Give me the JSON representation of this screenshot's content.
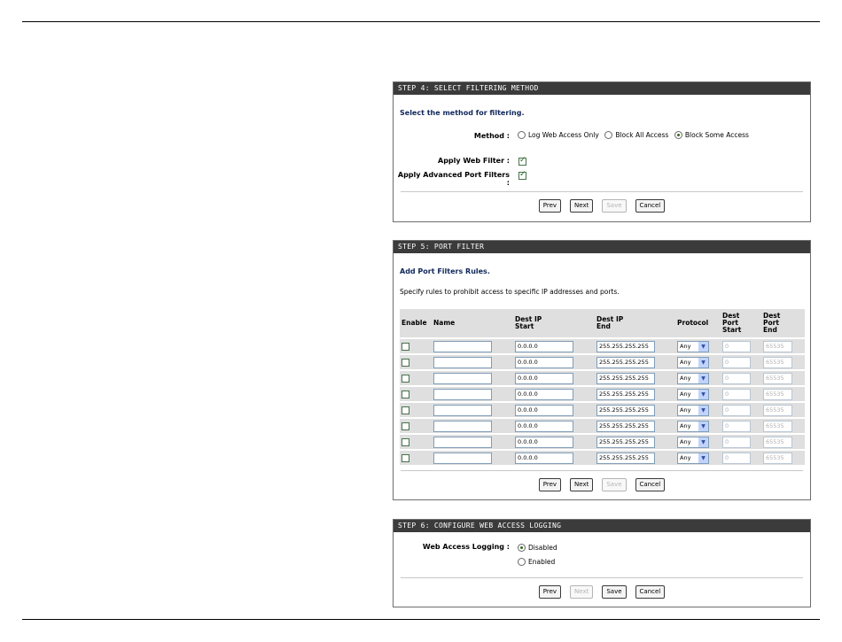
{
  "step4": {
    "header": "STEP 4: SELECT FILTERING METHOD",
    "subheading": "Select the method for filtering.",
    "method_label": "Method :",
    "method_options": [
      "Log Web Access Only",
      "Block All Access",
      "Block Some Access"
    ],
    "method_selected": 2,
    "apply_web_filter_label": "Apply Web Filter :",
    "apply_web_filter_checked": true,
    "apply_port_filters_label": "Apply Advanced Port Filters :",
    "apply_port_filters_checked": true,
    "buttons": {
      "prev": "Prev",
      "next": "Next",
      "save": "Save",
      "cancel": "Cancel"
    }
  },
  "step5": {
    "header": "STEP 5: PORT FILTER",
    "subheading": "Add Port Filters Rules.",
    "description": "Specify rules to prohibit access to specific IP addresses and ports.",
    "columns": {
      "enable": "Enable",
      "name": "Name",
      "dest_ip_start": [
        "Dest IP",
        "Start"
      ],
      "dest_ip_end": [
        "Dest IP",
        "End"
      ],
      "protocol": "Protocol",
      "dest_port_start": [
        "Dest",
        "Port",
        "Start"
      ],
      "dest_port_end": [
        "Dest",
        "Port",
        "End"
      ]
    },
    "rows": [
      {
        "enabled": false,
        "name": "",
        "ip_start": "0.0.0.0",
        "ip_end": "255.255.255.255",
        "protocol": "Any",
        "port_start": "0",
        "port_end": "65535"
      },
      {
        "enabled": false,
        "name": "",
        "ip_start": "0.0.0.0",
        "ip_end": "255.255.255.255",
        "protocol": "Any",
        "port_start": "0",
        "port_end": "65535"
      },
      {
        "enabled": false,
        "name": "",
        "ip_start": "0.0.0.0",
        "ip_end": "255.255.255.255",
        "protocol": "Any",
        "port_start": "0",
        "port_end": "65535"
      },
      {
        "enabled": false,
        "name": "",
        "ip_start": "0.0.0.0",
        "ip_end": "255.255.255.255",
        "protocol": "Any",
        "port_start": "0",
        "port_end": "65535"
      },
      {
        "enabled": false,
        "name": "",
        "ip_start": "0.0.0.0",
        "ip_end": "255.255.255.255",
        "protocol": "Any",
        "port_start": "0",
        "port_end": "65535"
      },
      {
        "enabled": false,
        "name": "",
        "ip_start": "0.0.0.0",
        "ip_end": "255.255.255.255",
        "protocol": "Any",
        "port_start": "0",
        "port_end": "65535"
      },
      {
        "enabled": false,
        "name": "",
        "ip_start": "0.0.0.0",
        "ip_end": "255.255.255.255",
        "protocol": "Any",
        "port_start": "0",
        "port_end": "65535"
      },
      {
        "enabled": false,
        "name": "",
        "ip_start": "0.0.0.0",
        "ip_end": "255.255.255.255",
        "protocol": "Any",
        "port_start": "0",
        "port_end": "65535"
      }
    ],
    "buttons": {
      "prev": "Prev",
      "next": "Next",
      "save": "Save",
      "cancel": "Cancel"
    }
  },
  "step6": {
    "header": "STEP 6: CONFIGURE WEB ACCESS LOGGING",
    "logging_label": "Web Access Logging :",
    "options": [
      "Disabled",
      "Enabled"
    ],
    "selected": 0,
    "buttons": {
      "prev": "Prev",
      "next": "Next",
      "save": "Save",
      "cancel": "Cancel"
    }
  },
  "colors": {
    "header_bg": "#3b3b3b",
    "subheading": "#10275b",
    "table_bg": "#dfdfdf"
  }
}
